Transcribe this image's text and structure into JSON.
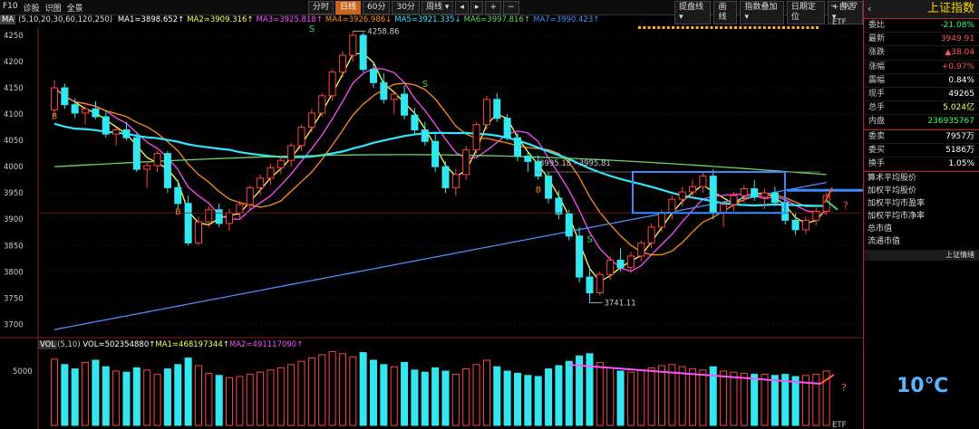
{
  "topbar": {
    "left": [
      "F10",
      "诊股",
      "识图",
      "全景"
    ],
    "periods": [
      "分时",
      "日线",
      "60分",
      "30分",
      "周线"
    ],
    "active_period": "日线",
    "right_buttons": [
      "提盘线",
      "画线",
      "指数叠加",
      "日期定位",
      "+自选"
    ],
    "icons": [
      "chevron-left-icon",
      "chevron-right-icon",
      "plus-icon",
      "minus-icon",
      "settings-icon"
    ]
  },
  "ma_legend": {
    "label": "MA",
    "params": "(5,10,20,30,60,120,250)",
    "items": [
      {
        "text": "MA1=3898.652↑",
        "color": "#ffffff"
      },
      {
        "text": "MA2=3909.316↑",
        "color": "#ffff4d"
      },
      {
        "text": "MA3=3925.818↑",
        "color": "#ff4dff"
      },
      {
        "text": "MA4=3926.986↓",
        "color": "#ff8c1a"
      },
      {
        "text": "MA5=3921.335↓",
        "color": "#33e6ff"
      },
      {
        "text": "MA6=3997.816↑",
        "color": "#66d966"
      },
      {
        "text": "MA7=3990.423↑",
        "color": "#4d8cff"
      }
    ]
  },
  "vol_legend": {
    "label": "VOL",
    "params": "(5,10)",
    "items": [
      {
        "text": "VOL=502354880↑",
        "color": "#ffffff"
      },
      {
        "text": "MA1=468197344↑",
        "color": "#ffff4d"
      },
      {
        "text": "MA2=491117090↑",
        "color": "#ff4dff"
      }
    ]
  },
  "chart_data": {
    "type": "candlestick",
    "y_ticks": [
      4250,
      4200,
      4150,
      4100,
      4050,
      4000,
      3950,
      3900,
      3850,
      3800,
      3750,
      3700
    ],
    "y_range": [
      3680,
      4262
    ],
    "annotations": {
      "high": "4258.86",
      "low": "3741.11",
      "range_label": "3995.18 - 3995.81",
      "question_marks": [
        "?",
        "?"
      ],
      "etf_label": "ETF",
      "signal_s": "S",
      "signal_b": "B"
    },
    "candles": [
      [
        4108,
        4165,
        4095,
        4150
      ],
      [
        4150,
        4158,
        4110,
        4118
      ],
      [
        4118,
        4130,
        4092,
        4102
      ],
      [
        4102,
        4115,
        4080,
        4110
      ],
      [
        4110,
        4125,
        4090,
        4095
      ],
      [
        4095,
        4108,
        4055,
        4062
      ],
      [
        4062,
        4075,
        4040,
        4070
      ],
      [
        4070,
        4085,
        4050,
        4055
      ],
      [
        4055,
        4065,
        3990,
        3995
      ],
      [
        3995,
        4010,
        3960,
        4002
      ],
      [
        4002,
        4030,
        3990,
        4025
      ],
      [
        4025,
        4030,
        3950,
        3960
      ],
      [
        3960,
        3975,
        3920,
        3930
      ],
      [
        3930,
        3945,
        3850,
        3855
      ],
      [
        3855,
        3905,
        3850,
        3895
      ],
      [
        3895,
        3925,
        3885,
        3918
      ],
      [
        3918,
        3930,
        3885,
        3892
      ],
      [
        3892,
        3920,
        3878,
        3912
      ],
      [
        3912,
        3935,
        3900,
        3928
      ],
      [
        3928,
        3965,
        3918,
        3960
      ],
      [
        3960,
        3985,
        3945,
        3978
      ],
      [
        3978,
        4005,
        3965,
        3998
      ],
      [
        3998,
        4020,
        3985,
        4012
      ],
      [
        4012,
        4045,
        4000,
        4040
      ],
      [
        4040,
        4080,
        4030,
        4075
      ],
      [
        4075,
        4110,
        4065,
        4102
      ],
      [
        4102,
        4140,
        4095,
        4135
      ],
      [
        4135,
        4185,
        4125,
        4180
      ],
      [
        4180,
        4220,
        4170,
        4212
      ],
      [
        4212,
        4258,
        4200,
        4250
      ],
      [
        4250,
        4255,
        4180,
        4185
      ],
      [
        4185,
        4200,
        4150,
        4160
      ],
      [
        4160,
        4178,
        4120,
        4128
      ],
      [
        4128,
        4145,
        4100,
        4138
      ],
      [
        4138,
        4155,
        4090,
        4098
      ],
      [
        4098,
        4112,
        4060,
        4070
      ],
      [
        4070,
        4085,
        4040,
        4048
      ],
      [
        4048,
        4062,
        3990,
        4000
      ],
      [
        4000,
        4010,
        3950,
        3960
      ],
      [
        3960,
        3995,
        3945,
        3985
      ],
      [
        3985,
        4040,
        3975,
        4032
      ],
      [
        4032,
        4085,
        4025,
        4080
      ],
      [
        4080,
        4135,
        4070,
        4128
      ],
      [
        4128,
        4140,
        4085,
        4092
      ],
      [
        4092,
        4100,
        4050,
        4055
      ],
      [
        4055,
        4065,
        4010,
        4020
      ],
      [
        4020,
        4030,
        3990,
        4010
      ],
      [
        4010,
        4022,
        3975,
        3982
      ],
      [
        3982,
        3990,
        3930,
        3940
      ],
      [
        3940,
        3955,
        3900,
        3910
      ],
      [
        3910,
        3918,
        3860,
        3868
      ],
      [
        3868,
        3885,
        3780,
        3790
      ],
      [
        3790,
        3810,
        3741,
        3760
      ],
      [
        3760,
        3800,
        3755,
        3795
      ],
      [
        3795,
        3830,
        3785,
        3822
      ],
      [
        3822,
        3845,
        3800,
        3808
      ],
      [
        3808,
        3838,
        3798,
        3830
      ],
      [
        3830,
        3860,
        3820,
        3855
      ],
      [
        3855,
        3892,
        3845,
        3885
      ],
      [
        3885,
        3918,
        3875,
        3912
      ],
      [
        3912,
        3945,
        3900,
        3938
      ],
      [
        3938,
        3962,
        3925,
        3952
      ],
      [
        3952,
        3975,
        3940,
        3962
      ],
      [
        3962,
        3990,
        3950,
        3982
      ],
      [
        3982,
        3995,
        3900,
        3912
      ],
      [
        3912,
        3935,
        3885,
        3928
      ],
      [
        3928,
        3952,
        3915,
        3945
      ],
      [
        3945,
        3965,
        3930,
        3958
      ],
      [
        3958,
        3975,
        3935,
        3942
      ],
      [
        3942,
        3958,
        3920,
        3950
      ],
      [
        3950,
        3962,
        3925,
        3932
      ],
      [
        3932,
        3945,
        3890,
        3898
      ],
      [
        3898,
        3912,
        3870,
        3880
      ],
      [
        3880,
        3905,
        3872,
        3898
      ],
      [
        3898,
        3922,
        3888,
        3915
      ],
      [
        3915,
        3950,
        3908,
        3945
      ]
    ],
    "ma_lines": [
      {
        "name": "MA1",
        "color": "#ffff4d",
        "period": 5
      },
      {
        "name": "MA2",
        "color": "#ff4dff",
        "period": 10
      },
      {
        "name": "MA3",
        "color": "#ff8c1a",
        "period": 20
      },
      {
        "name": "MA4",
        "color": "#33e6ff",
        "period": 60
      },
      {
        "name": "MA5",
        "color": "#66d966",
        "period": 120
      },
      {
        "name": "MA6",
        "color": "#4d8cff",
        "period": 250
      }
    ],
    "volume": [
      6100,
      5600,
      5200,
      5800,
      6000,
      5400,
      5000,
      4900,
      5300,
      5100,
      4700,
      5200,
      5600,
      6200,
      5500,
      4800,
      4600,
      4400,
      4500,
      4700,
      4900,
      5100,
      5300,
      5600,
      5900,
      6200,
      6500,
      6800,
      6600,
      6300,
      6700,
      6000,
      5600,
      5400,
      5800,
      5100,
      4900,
      5300,
      5000,
      4700,
      5200,
      5600,
      6000,
      5400,
      5000,
      4800,
      4600,
      4500,
      5200,
      5500,
      5900,
      6400,
      6600,
      5800,
      5300,
      5000,
      4900,
      5100,
      5300,
      5500,
      5600,
      5400,
      5200,
      5100,
      5400,
      5000,
      4900,
      4800,
      4700,
      4700,
      4600,
      4700,
      4500,
      4600,
      4700,
      5000
    ],
    "volume_ticks": [
      "5000"
    ]
  },
  "sidebar": {
    "title": "上证指数",
    "quotes": [
      {
        "k": "委比",
        "v": "-21.08%",
        "color": "#33ff66"
      },
      {
        "k": "最新",
        "v": "3949.91",
        "color": "#ff5555"
      },
      {
        "k": "涨跌",
        "v": "▲38.04",
        "color": "#ff5555"
      },
      {
        "k": "涨幅",
        "v": "+0.97%",
        "color": "#ff5555"
      },
      {
        "k": "震幅",
        "v": "0.84%",
        "color": "#ffffff"
      },
      {
        "k": "现手",
        "v": "49265",
        "color": "#ffffff"
      },
      {
        "k": "总手",
        "v": "5.024亿",
        "color": "#ffff66"
      },
      {
        "k": "内盘",
        "v": "236935767",
        "color": "#33ff66"
      }
    ],
    "quotes2": [
      {
        "k": "委卖",
        "v": "7957万",
        "color": "#ffffff"
      },
      {
        "k": "委买",
        "v": "5186万",
        "color": "#ffffff"
      },
      {
        "k": "换手",
        "v": "1.05%",
        "color": "#ffffff"
      }
    ],
    "links": [
      "算术平均股价",
      "加权平均股价",
      "加权平均市盈率",
      "加权平均市净率",
      "总市值",
      "流通市值"
    ],
    "bottom_bar": "上证情绪",
    "temperature": "10℃"
  }
}
